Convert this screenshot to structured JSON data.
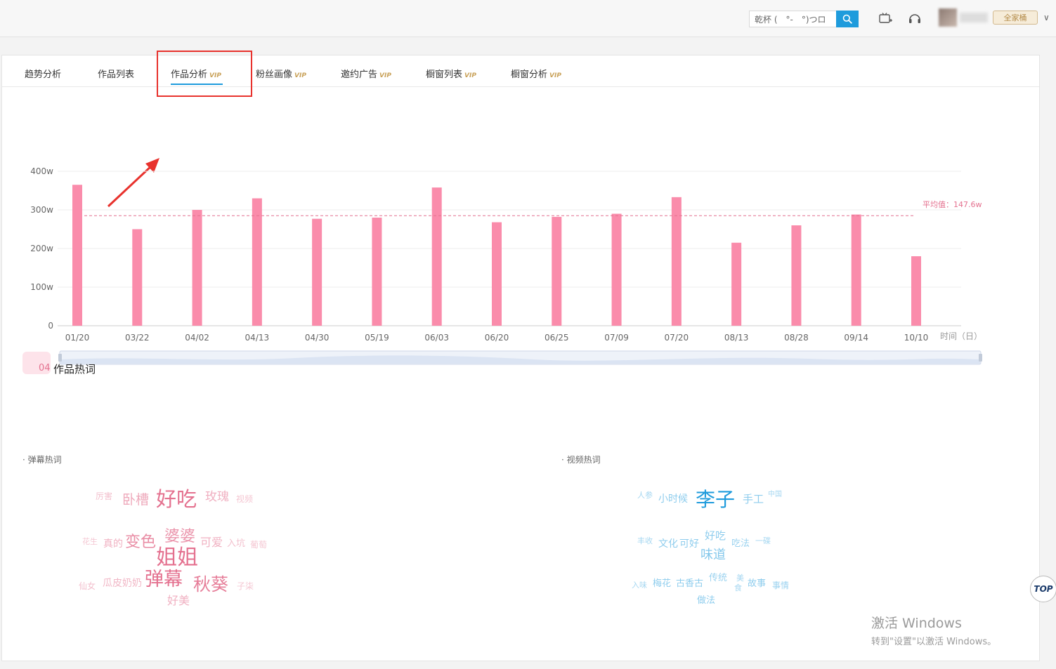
{
  "header": {
    "search_value": "乾杯 (　°-　°)つロ",
    "icons": [
      "search-icon",
      "tv-add-icon",
      "headset-icon"
    ],
    "account_badge": "全家桶",
    "account_chevron": "∨"
  },
  "tabs": [
    {
      "label": "趋势分析",
      "vip": ""
    },
    {
      "label": "作品列表",
      "vip": ""
    },
    {
      "label": "作品分析",
      "vip": "VIP"
    },
    {
      "label": "粉丝画像",
      "vip": "VIP"
    },
    {
      "label": "邀约广告",
      "vip": "VIP"
    },
    {
      "label": "橱窗列表",
      "vip": "VIP"
    },
    {
      "label": "橱窗分析",
      "vip": "VIP"
    }
  ],
  "active_tab": "作品分析",
  "colors": {
    "bar": "#fa8cab",
    "accent": "#1e9bdc",
    "highlight": "#e8322d",
    "avg": "#e4718f"
  },
  "chart_data": {
    "type": "bar",
    "categories": [
      "01/20",
      "03/22",
      "04/02",
      "04/13",
      "04/30",
      "05/19",
      "06/03",
      "06/20",
      "06/25",
      "07/09",
      "07/20",
      "08/13",
      "08/28",
      "09/14",
      "10/10"
    ],
    "values": [
      365,
      250,
      300,
      330,
      277,
      280,
      358,
      268,
      282,
      290,
      333,
      215,
      260,
      288,
      180
    ],
    "y_ticks": [
      "0",
      "100w",
      "200w",
      "300w",
      "400w"
    ],
    "ylim": [
      0,
      400
    ],
    "xlabel": "时间（日）",
    "ylabel": "",
    "average_value": 285,
    "average_label": "平均值：147.6w",
    "grid": true,
    "legend": "none",
    "has_zoom_slider": true
  },
  "hotwords_section": {
    "number": "04",
    "title": "作品热词"
  },
  "danmu_cloud": {
    "title": "· 弹幕热词",
    "color": "#e4718f",
    "words": [
      {
        "text": "厉害",
        "size": 12,
        "opacity": 0.45
      },
      {
        "text": "卧槽",
        "size": 19,
        "opacity": 0.6
      },
      {
        "text": "好吃",
        "size": 29,
        "opacity": 1.0
      },
      {
        "text": "玫瑰",
        "size": 17,
        "opacity": 0.55
      },
      {
        "text": "视频",
        "size": 12,
        "opacity": 0.4
      },
      {
        "text": "花生",
        "size": 11,
        "opacity": 0.4
      },
      {
        "text": "真的",
        "size": 14,
        "opacity": 0.55
      },
      {
        "text": "变色",
        "size": 22,
        "opacity": 0.8
      },
      {
        "text": "婆婆",
        "size": 22,
        "opacity": 0.75
      },
      {
        "text": "可爱",
        "size": 16,
        "opacity": 0.55
      },
      {
        "text": "入坑",
        "size": 13,
        "opacity": 0.45
      },
      {
        "text": "葡萄",
        "size": 12,
        "opacity": 0.4
      },
      {
        "text": "姐姐",
        "size": 30,
        "opacity": 1.0
      },
      {
        "text": "仙女",
        "size": 12,
        "opacity": 0.45
      },
      {
        "text": "瓜皮奶奶",
        "size": 14,
        "opacity": 0.5
      },
      {
        "text": "弹幕",
        "size": 27,
        "opacity": 1.0
      },
      {
        "text": "秋葵",
        "size": 25,
        "opacity": 0.9
      },
      {
        "text": "子柒",
        "size": 12,
        "opacity": 0.4
      },
      {
        "text": "好美",
        "size": 16,
        "opacity": 0.55
      }
    ]
  },
  "video_cloud": {
    "title": "· 视频热词",
    "color": "#1e9bdc",
    "words": [
      {
        "text": "人参",
        "size": 11,
        "opacity": 0.4
      },
      {
        "text": "小时候",
        "size": 14,
        "opacity": 0.5
      },
      {
        "text": "李子",
        "size": 28,
        "opacity": 1.0
      },
      {
        "text": "手工",
        "size": 15,
        "opacity": 0.5
      },
      {
        "text": "中国",
        "size": 10,
        "opacity": 0.4
      },
      {
        "text": "丰收",
        "size": 11,
        "opacity": 0.4
      },
      {
        "text": "文化",
        "size": 14,
        "opacity": 0.5
      },
      {
        "text": "可好",
        "size": 14,
        "opacity": 0.5
      },
      {
        "text": "好吃",
        "size": 15,
        "opacity": 0.5
      },
      {
        "text": "吃法",
        "size": 13,
        "opacity": 0.45
      },
      {
        "text": "一碟",
        "size": 11,
        "opacity": 0.4
      },
      {
        "text": "味道",
        "size": 18,
        "opacity": 0.55
      },
      {
        "text": "入味",
        "size": 11,
        "opacity": 0.4
      },
      {
        "text": "梅花",
        "size": 13,
        "opacity": 0.5
      },
      {
        "text": "古香古",
        "size": 13,
        "opacity": 0.5
      },
      {
        "text": "传统",
        "size": 13,
        "opacity": 0.45
      },
      {
        "text": "美",
        "size": 11,
        "opacity": 0.4
      },
      {
        "text": "食",
        "size": 11,
        "opacity": 0.4
      },
      {
        "text": "故事",
        "size": 13,
        "opacity": 0.5
      },
      {
        "text": "事情",
        "size": 12,
        "opacity": 0.45
      },
      {
        "text": "做法",
        "size": 13,
        "opacity": 0.5
      }
    ]
  },
  "top_button": "TOP",
  "watermark": {
    "line1": "激活 Windows",
    "line2": "转到\"设置\"以激活 Windows。"
  }
}
